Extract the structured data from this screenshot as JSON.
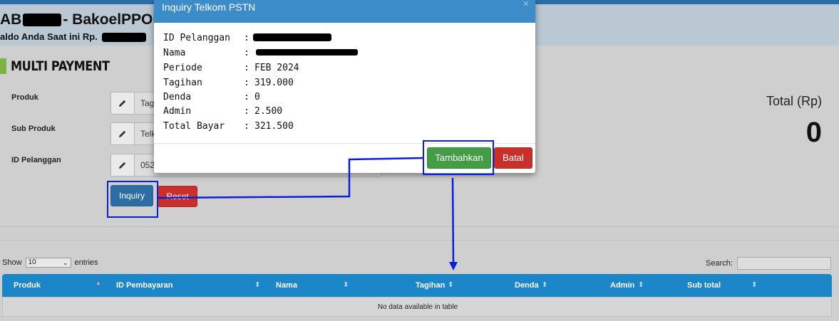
{
  "header": {
    "title_prefix": "AB",
    "title_suffix": "- BakoelPPOB",
    "saldo_prefix": "aldo Anda Saat ini Rp."
  },
  "section": {
    "title": "MULTI PAYMENT"
  },
  "form": {
    "produk_label": "Produk",
    "produk_value": "Tag",
    "sub_produk_label": "Sub Produk",
    "sub_produk_value": "Telk",
    "id_pelanggan_label": "ID Pelanggan",
    "id_pelanggan_value": "052",
    "inquiry_label": "Inquiry",
    "reset_label": "Reset"
  },
  "total": {
    "label": "Total (Rp)",
    "value": "0"
  },
  "table": {
    "show_label": "Show",
    "entries_label": "entries",
    "page_size": "10",
    "search_label": "Search:",
    "columns": [
      "Produk",
      "ID Pembayaran",
      "Nama",
      "Tagihan",
      "Denda",
      "Admin",
      "Sub total"
    ],
    "empty_text": "No data available in table"
  },
  "modal": {
    "title": "Inquiry Telkom PSTN",
    "close_symbol": "×",
    "rows": [
      {
        "key": "ID Pelanggan",
        "sep": ":",
        "value": ""
      },
      {
        "key": "Nama",
        "sep": ":",
        "value": ""
      },
      {
        "key": "Periode",
        "sep": ":",
        "value": "FEB 2024"
      },
      {
        "key": "Tagihan",
        "sep": ":",
        "value": "319.000"
      },
      {
        "key": "Denda",
        "sep": ":",
        "value": "0"
      },
      {
        "key": "Admin",
        "sep": ":",
        "value": "2.500"
      },
      {
        "key": "Total Bayar",
        "sep": ":",
        "value": "321.500"
      }
    ],
    "add_label": "Tambahkan",
    "cancel_label": "Batal"
  },
  "colors": {
    "accent_blue": "#1b86c8",
    "highlight": "#0b1fd6",
    "success": "#449d44",
    "danger": "#c9302c"
  }
}
